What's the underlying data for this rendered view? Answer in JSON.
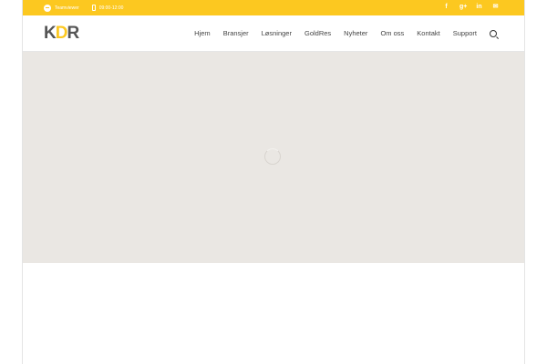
{
  "topbar": {
    "contact_text": "Teamviewer",
    "hours": "09:00-12:00",
    "social": [
      "facebook",
      "google-plus",
      "linkedin",
      "email"
    ]
  },
  "header": {
    "logo": "KDR",
    "nav": [
      "Hjem",
      "Bransjer",
      "Løsninger",
      "GoldRes",
      "Nyheter",
      "Om oss",
      "Kontakt",
      "Support"
    ]
  }
}
